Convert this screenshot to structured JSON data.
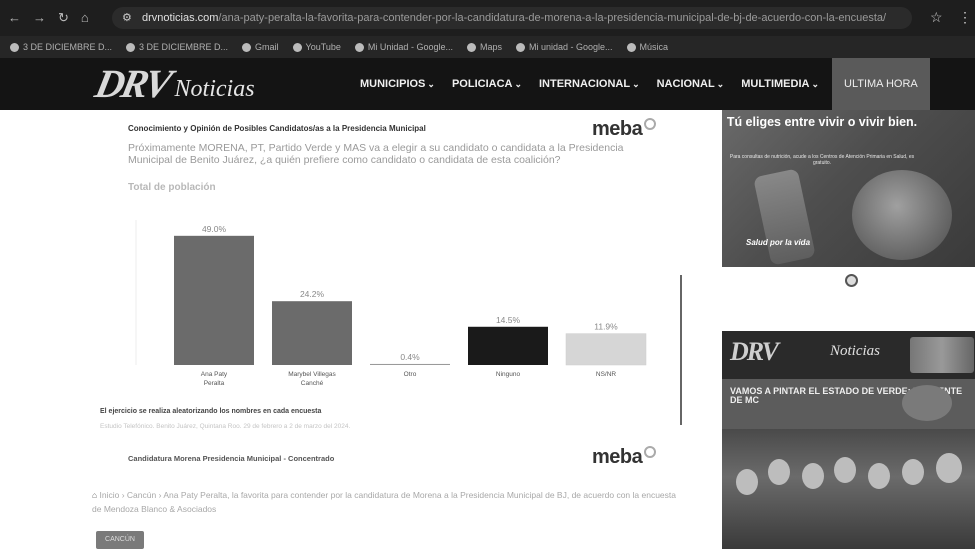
{
  "browser": {
    "url_domain": "drvnoticias.com",
    "url_path": "/ana-paty-peralta-la-favorita-para-contender-por-la-candidatura-de-morena-a-la-presidencia-municipal-de-bj-de-acuerdo-con-la-encuesta/",
    "bookmarks": [
      "3 DE DICIEMBRE D...",
      "3 DE DICIEMBRE D...",
      "Gmail",
      "YouTube",
      "Mi Unidad - Google...",
      "Maps",
      "Mi unidad - Google...",
      "Música"
    ]
  },
  "site": {
    "logo_mark": "DRV",
    "logo_sub": "Noticias",
    "menu": [
      {
        "label": "MUNICIPIOS",
        "chevron": true
      },
      {
        "label": "POLICIACA",
        "chevron": true
      },
      {
        "label": "INTERNACIONAL",
        "chevron": true
      },
      {
        "label": "NACIONAL",
        "chevron": true
      },
      {
        "label": "MULTIMEDIA",
        "chevron": true
      },
      {
        "label": "ULTIMA HORA",
        "chevron": false
      }
    ]
  },
  "survey": {
    "header": "Conocimiento y Opinión de Posibles Candidatos/as a la Presidencia Municipal",
    "brand": "meba",
    "question": "Próximamente MORENA, PT, Partido Verde y MAS va a elegir a su candidato o candidata a la Presidencia Municipal de Benito Juárez, ¿a quién prefiere como candidato o candidata de esta coalición?",
    "subtitle": "Total de población",
    "note": "El ejercicio se realiza aleatorizando los nombres en cada encuesta",
    "source": "Estudio Telefónico. Benito Juárez, Quintana Roo. 29 de febrero a 2 de marzo del 2024.",
    "next_title": "Candidatura Morena Presidencia Municipal - Concentrado"
  },
  "chart_data": {
    "type": "bar",
    "categories": [
      "Ana Paty Peralta",
      "Marybel Villegas Canché",
      "Otro",
      "Ninguno",
      "NS/NR"
    ],
    "values": [
      49.0,
      24.2,
      0.4,
      14.5,
      11.9
    ],
    "value_labels": [
      "49.0%",
      "24.2%",
      "0.4%",
      "14.5%",
      "11.9%"
    ],
    "colors": [
      "#6b6b6b",
      "#6b6b6b",
      "#9a9a9a",
      "#1a1a1a",
      "#d6d6d6"
    ],
    "title": "",
    "ylim": [
      0,
      55
    ],
    "grid": false
  },
  "article": {
    "breadcrumb_home": "Inicio",
    "breadcrumb_section": "Cancún",
    "breadcrumb_title": "Ana Paty Peralta, la favorita para contender por la candidatura de Morena a la Presidencia Municipal de BJ, de acuerdo con la encuesta de Mendoza Blanco & Asociados",
    "tag": "CANCÚN"
  },
  "sidebar": {
    "ad1_title": "Tú eliges entre vivir o vivir bien.",
    "ad1_body": "Para consultas de nutrición, acude a los Centros de Atención Primaria en Salud, es gratuito.",
    "ad1_brand": "Salud por la vida",
    "ad2_logo": "DRV",
    "ad2_sub": "Noticias",
    "ad3_text": "VAMOS A PINTAR EL ESTADO DE VERDE: DIRIGENTE DE MC"
  }
}
